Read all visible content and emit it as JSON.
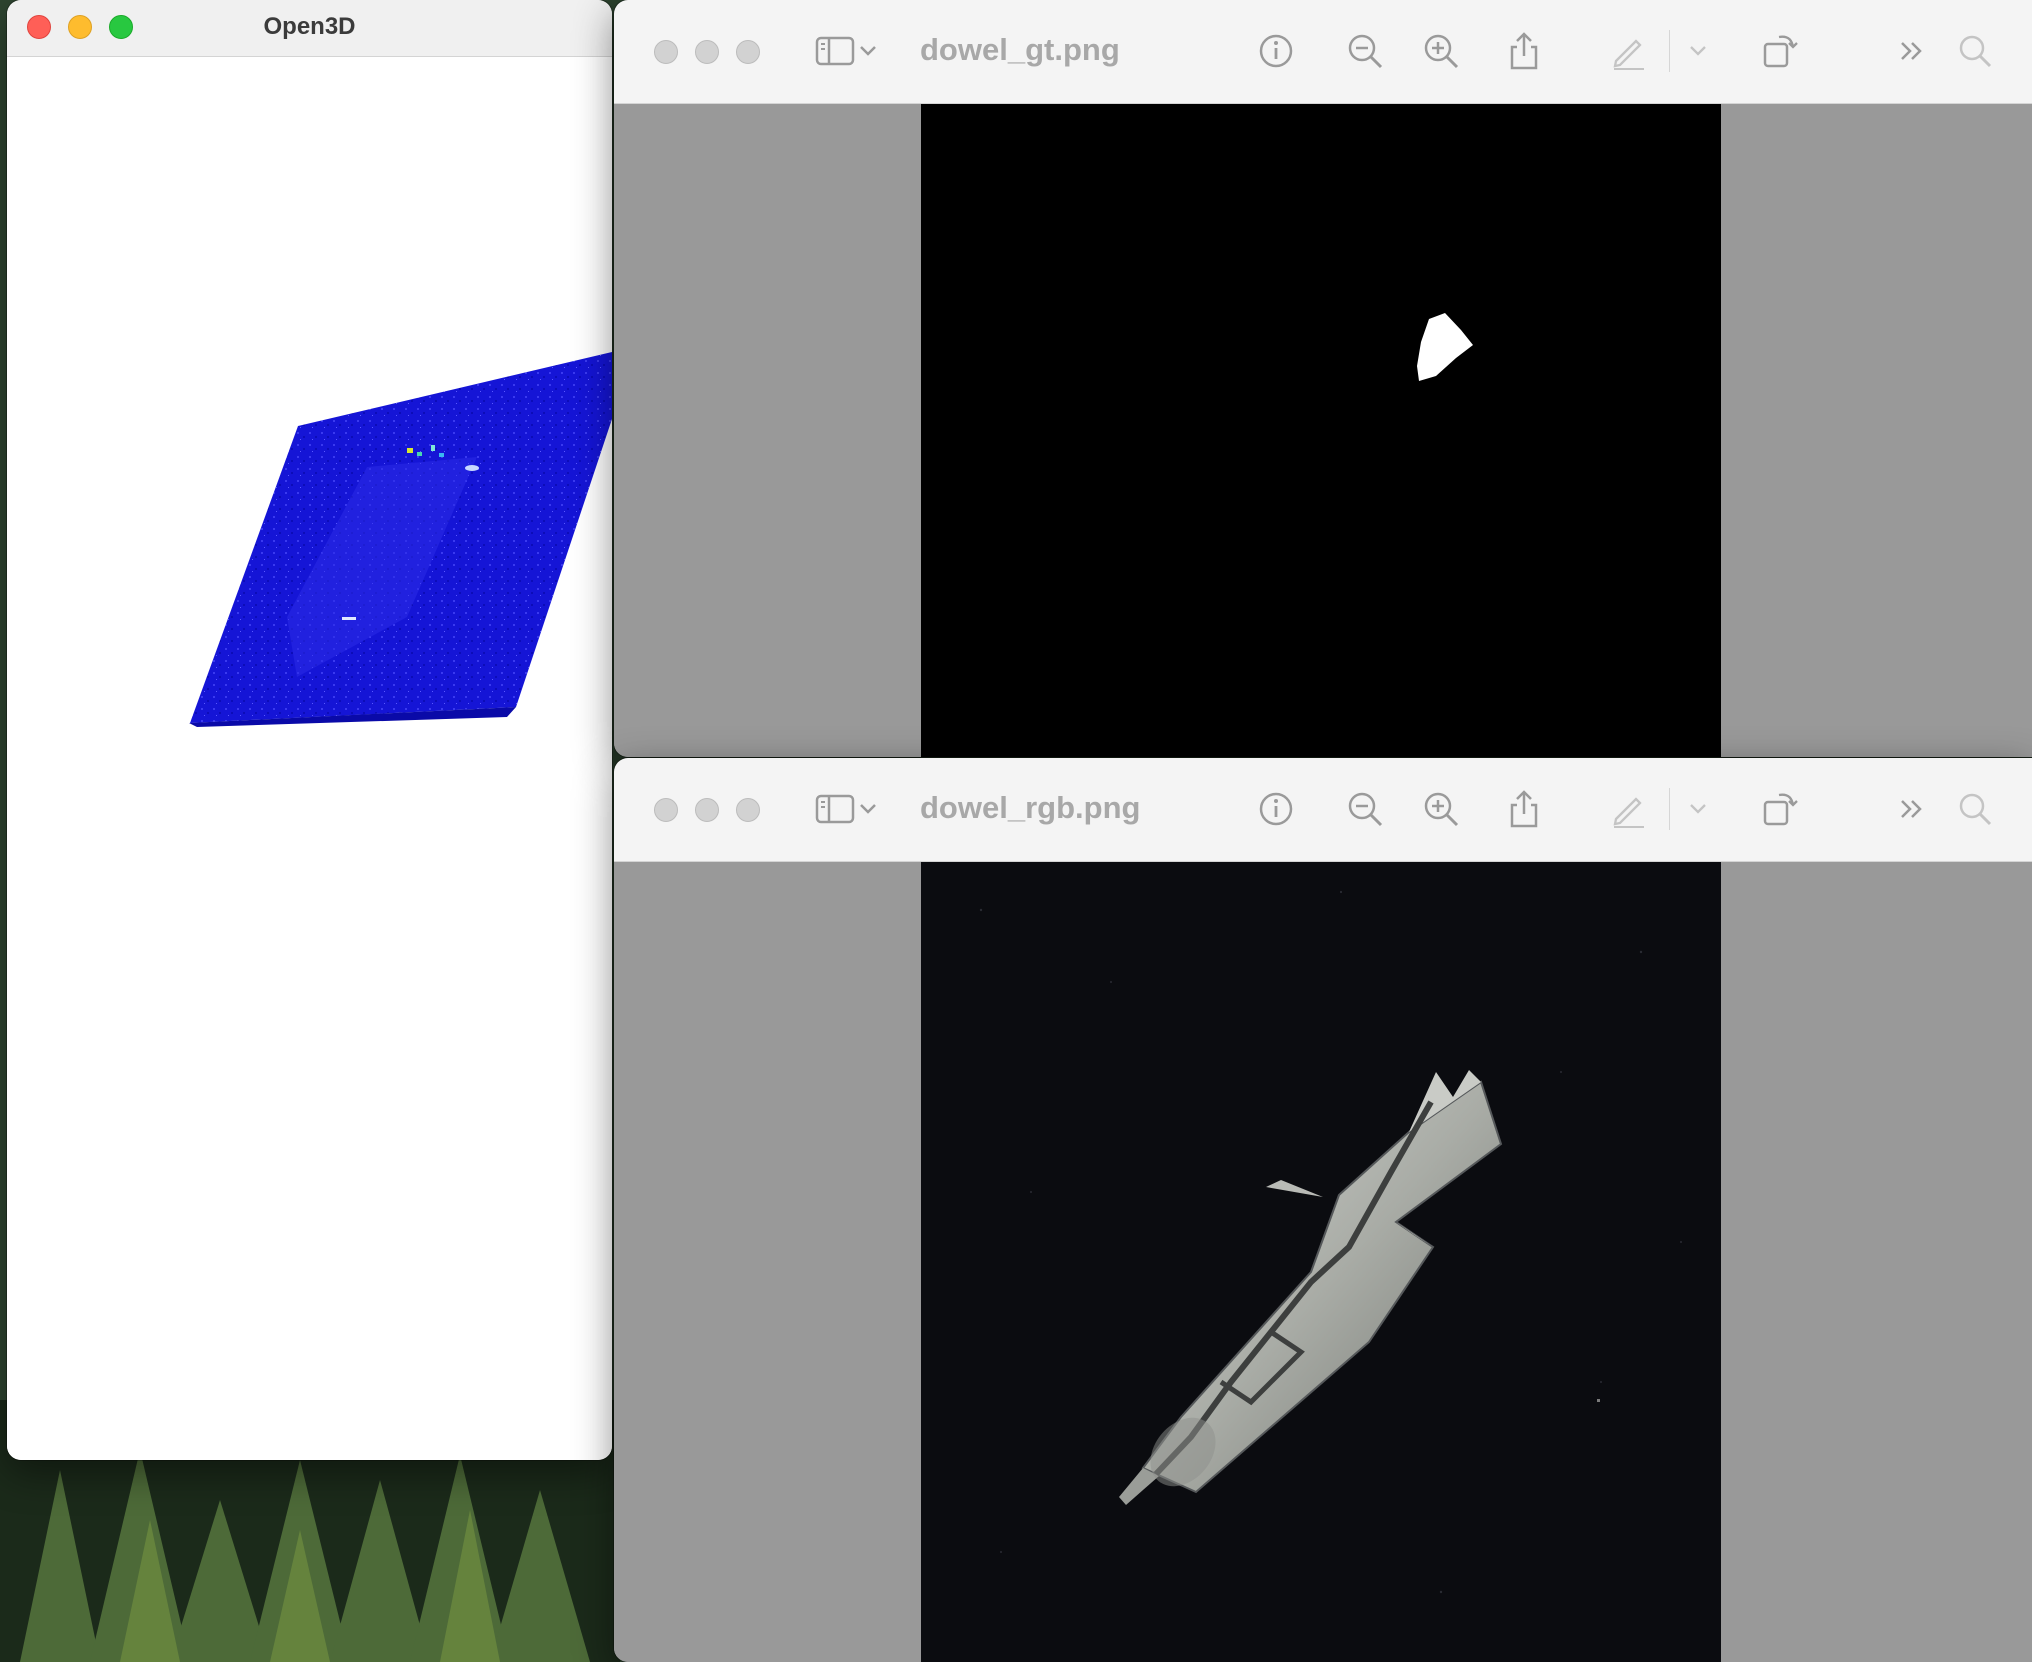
{
  "open3d_window": {
    "title": "Open3D"
  },
  "preview_gt": {
    "filename": "dowel_gt.png"
  },
  "preview_rgb": {
    "filename": "dowel_rgb.png"
  },
  "toolbar_icons": [
    "sidebar-icon",
    "chevron-down-icon",
    "info-icon",
    "zoom-out-icon",
    "zoom-in-icon",
    "share-icon",
    "markup-pencil-icon",
    "chevron-down-icon",
    "rotate-icon",
    "more-chevrons-icon",
    "search-icon"
  ],
  "colors": {
    "heatmap_blue": "#1a1ad8",
    "mask_white": "#ffffff",
    "titlebar": "#f0f0f0",
    "viewer_gray": "#999999"
  }
}
